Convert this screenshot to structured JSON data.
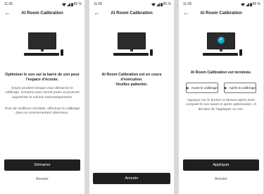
{
  "status": {
    "time": "11:05",
    "battery": "85 %",
    "icons": [
      "wifi-icon",
      "signal-icon",
      "battery-icon"
    ]
  },
  "app_title": "AI Room Calibration",
  "back_glyph": "←",
  "screen1": {
    "heading": "Optimiser le son sur la barre de son pour l'espace d'écoute.",
    "para1": "Soyez prudent lorsque vous démarrez le calibrage. Certains sons seront joués et pourront augmenter le volume automatiquement.",
    "para2": "Pour de meilleurs résultats, effectuez le calibrage dans un environnement silencieux.",
    "primary_label": "Démarrer",
    "cancel_label": "Annuler"
  },
  "screen2": {
    "status_line": "AI Room Calibration est en cours d'exécution.",
    "wait_line": "Veuillez patienter.",
    "primary_label": "Annuler"
  },
  "screen3": {
    "done_line": "AI Room Calibration est terminée.",
    "before_label": "Avant le calibrage",
    "after_label": "Après le calibrage",
    "para": "Appuyez sur le bouton ci-dessus après avoir comparé le son avant et après optimisation, et décidez de l'appliquer ou non.",
    "primary_label": "Appliquer",
    "cancel_label": "Annuler"
  },
  "colors": {
    "accent": "#16a3d6",
    "button_dark": "#1f1f1f"
  }
}
